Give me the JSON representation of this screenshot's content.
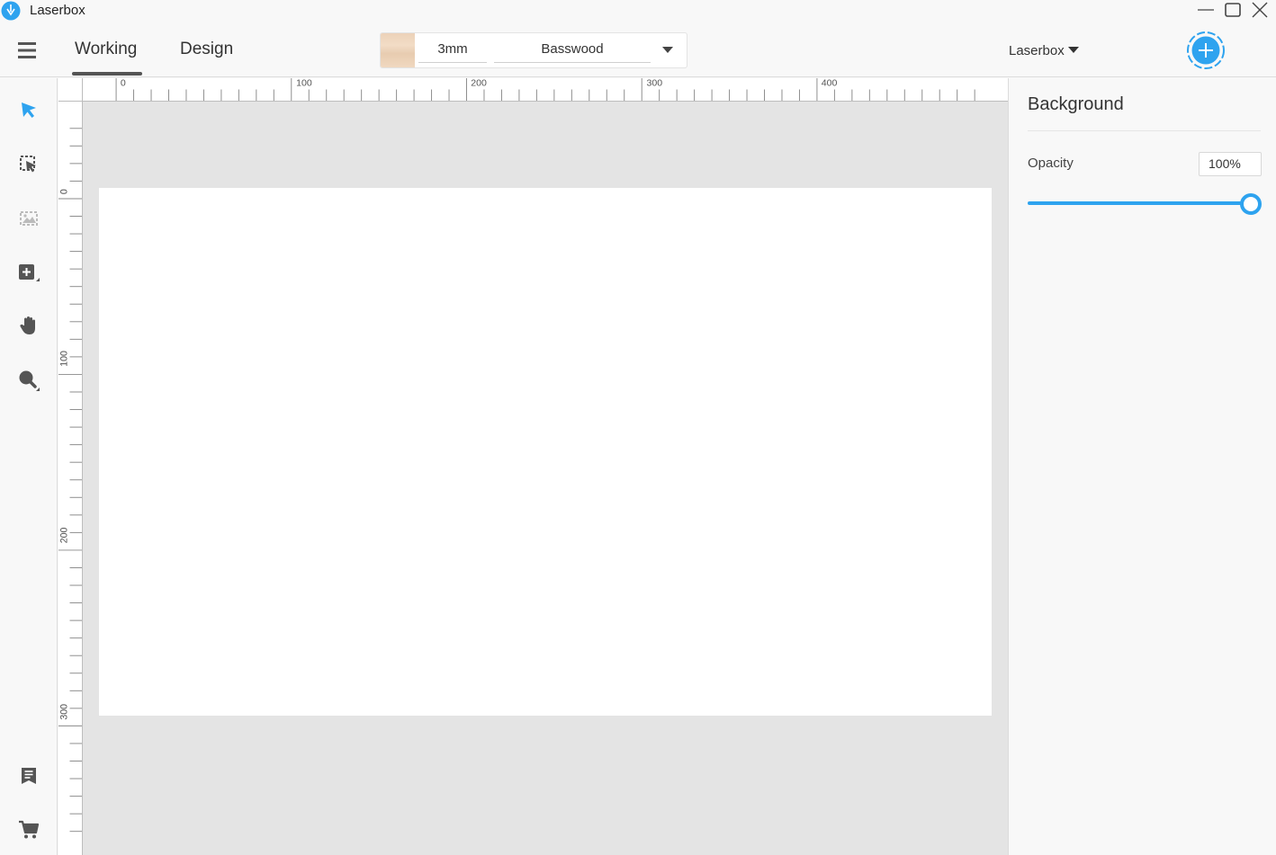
{
  "app": {
    "title": "Laserbox"
  },
  "header": {
    "tabs": [
      {
        "label": "Working",
        "active": true
      },
      {
        "label": "Design",
        "active": false
      }
    ],
    "material": {
      "thickness": "3mm",
      "name": "Basswood"
    },
    "device": "Laserbox"
  },
  "rulers": {
    "horizontal_labels": [
      "0",
      "100",
      "200",
      "300",
      "400"
    ],
    "vertical_labels": [
      "0",
      "100",
      "200",
      "300"
    ]
  },
  "panel": {
    "title": "Background",
    "opacity_label": "Opacity",
    "opacity_value": "100%",
    "opacity_level": 1.0
  },
  "colors": {
    "accent": "#2ea3ef",
    "canvas_bg": "#e4e4e4",
    "toolbar_icon": "#555555"
  },
  "icons": {
    "toolbar": [
      "select-arrow-icon",
      "marquee-select-icon",
      "image-icon",
      "add-shape-icon",
      "hand-pan-icon",
      "zoom-icon"
    ],
    "toolbar_bottom": [
      "document-icon",
      "cart-icon"
    ]
  }
}
